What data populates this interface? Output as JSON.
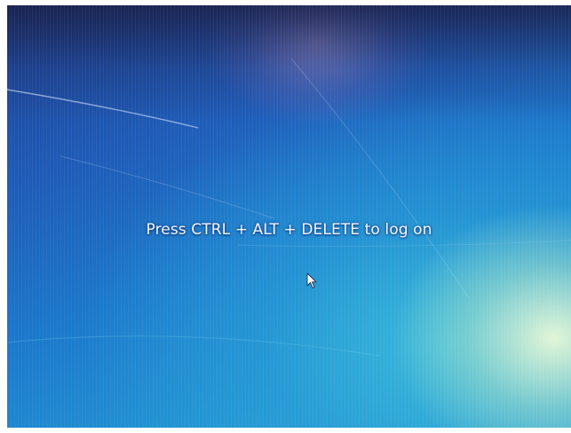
{
  "logon_screen": {
    "message": "Press CTRL + ALT + DELETE to log on"
  },
  "pointer": {
    "icon": "mouse-pointer-icon"
  },
  "colors": {
    "background_deep": "#1d3f8f",
    "background_mid": "#1b79cc",
    "background_light": "#31a6d4",
    "message_text": "#f4f8ff"
  }
}
